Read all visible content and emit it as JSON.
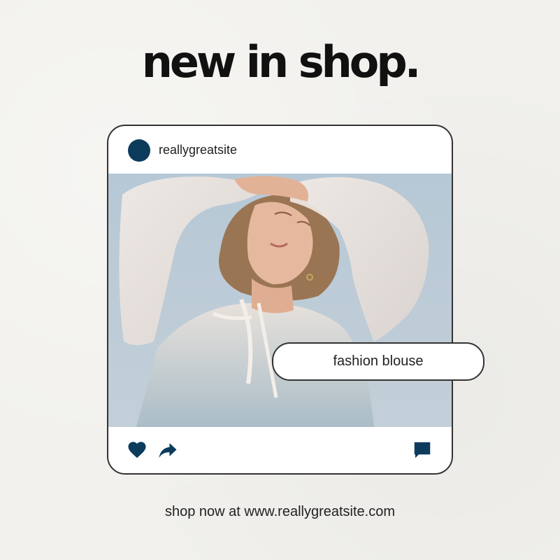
{
  "headline": "new in shop.",
  "post": {
    "username": "reallygreatsite",
    "tag": "fashion blouse",
    "icons": {
      "like": "heart-icon",
      "share": "share-arrow-icon",
      "comment": "comment-bubble-icon"
    }
  },
  "footer": "shop now at www.reallygreatsite.com",
  "colors": {
    "background": "#f1f0ec",
    "accent": "#0d3b5c",
    "text": "#111111",
    "border": "#333333"
  }
}
